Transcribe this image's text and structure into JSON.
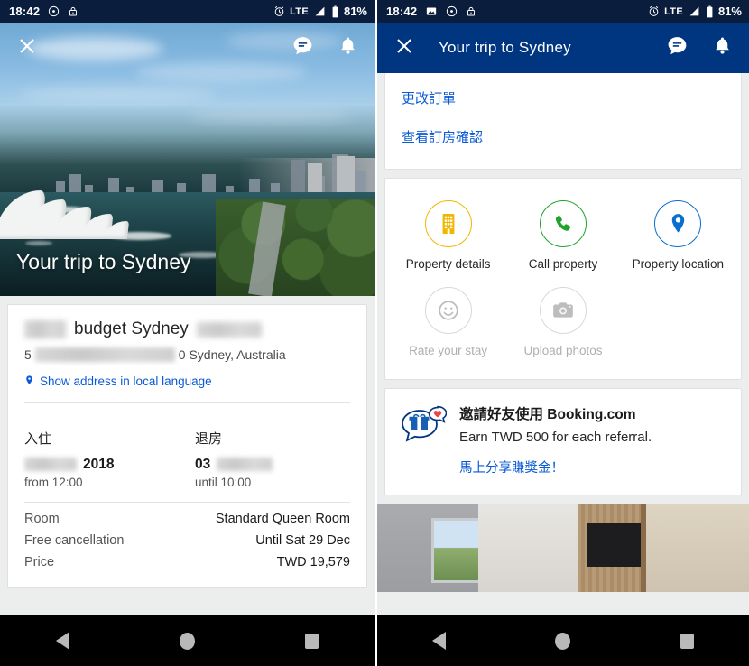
{
  "status_bar": {
    "time": "18:42",
    "network": "LTE",
    "battery": "81%",
    "icons_left": [
      "image-icon",
      "clock-icon",
      "lock-icon"
    ],
    "icons_right": [
      "alarm-icon",
      "signal-icon",
      "battery-icon"
    ]
  },
  "left_screen": {
    "hero": {
      "title": "Your trip to Sydney",
      "close_label": "✕",
      "chat_icon": "chat-icon",
      "bell_icon": "bell-icon"
    },
    "property": {
      "name_visible": "budget Sydney",
      "name_prefix_redacted": true,
      "name_suffix_redacted": true,
      "address_prefix": "5",
      "address_suffix": "0 Sydney, Australia",
      "address_redacted": true,
      "local_language_link": "Show address in local language",
      "pin_icon": "map-pin-icon"
    },
    "dates": {
      "checkin_label": "入住",
      "checkin_value": "2018",
      "checkin_value_redacted": true,
      "checkin_time": "from 12:00",
      "checkout_label": "退房",
      "checkout_value": "03",
      "checkout_value_redacted": true,
      "checkout_time": "until 10:00"
    },
    "facts": [
      {
        "key": "Room",
        "value": "Standard Queen Room"
      },
      {
        "key": "Free cancellation",
        "value": "Until Sat 29 Dec"
      },
      {
        "key": "Price",
        "value": "TWD 19,579"
      }
    ]
  },
  "right_screen": {
    "appbar": {
      "title": "Your trip to Sydney",
      "close_label": "✕",
      "chat_icon": "chat-icon",
      "bell_icon": "bell-icon"
    },
    "links": [
      {
        "label": "更改訂單"
      },
      {
        "label": "查看訂房確認"
      }
    ],
    "actions": [
      {
        "label": "Property details",
        "icon": "building-icon",
        "color": "#f2b600",
        "enabled": true
      },
      {
        "label": "Call property",
        "icon": "phone-icon",
        "color": "#1fa32b",
        "enabled": true
      },
      {
        "label": "Property location",
        "icon": "map-pin-icon",
        "color": "#0a6ed1",
        "enabled": true
      },
      {
        "label": "Rate your stay",
        "icon": "smiley-icon",
        "color": "#b0b0b0",
        "enabled": false
      },
      {
        "label": "Upload photos",
        "icon": "camera-icon",
        "color": "#b0b0b0",
        "enabled": false
      }
    ],
    "referral": {
      "icon": "gift-bubble-icon",
      "title": "邀請好友使用 Booking.com",
      "subtitle": "Earn TWD 500 for each referral.",
      "cta": "馬上分享賺獎金！"
    },
    "photo_caption": "hotel-room-photo"
  },
  "nav_bar": {
    "back": "back-button",
    "home": "home-button",
    "recents": "recents-button"
  },
  "colors": {
    "brand_blue": "#003580",
    "status_bar": "#0a1d3d",
    "link_blue": "#0a5ad6",
    "amber": "#f2b600",
    "green": "#1fa32b",
    "blue": "#0a6ed1",
    "muted": "#b0b0b0"
  }
}
